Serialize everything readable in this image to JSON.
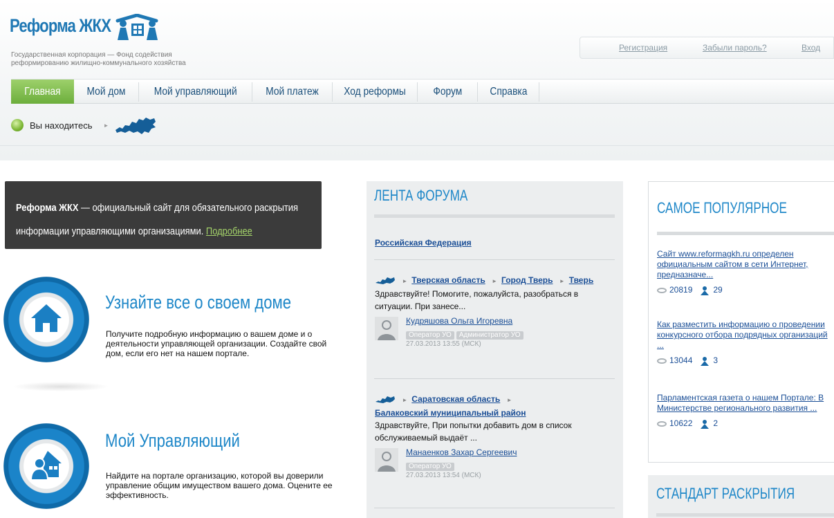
{
  "header": {
    "logo_title": "Реформа ЖКХ",
    "logo_subtitle_1": "Государственная корпорация — Фонд содействия",
    "logo_subtitle_2": "реформированию жилищно-коммунального хозяйства",
    "register": "Регистрация",
    "forgot_password": "Забыли пароль?",
    "login": "Вход"
  },
  "nav": {
    "items": [
      {
        "label": "Главная"
      },
      {
        "label": "Мой дом"
      },
      {
        "label": "Мой управляющий"
      },
      {
        "label": "Мой платеж"
      },
      {
        "label": "Ход реформы"
      },
      {
        "label": "Форум"
      },
      {
        "label": "Справка"
      }
    ],
    "active_color": "#7cbc48"
  },
  "breadcrumb": {
    "label": "Вы находитесь"
  },
  "intro": {
    "bold": "Реформа ЖКХ",
    "line1": " — официальный сайт для обязательного раскрытия",
    "line2": "информации управляющими организациями. ",
    "more": "Подробнее"
  },
  "features": [
    {
      "icon": "house-icon",
      "title": "Узнайте все о своем доме",
      "text": "Получите подробную информацию о вашем доме и о деятельности управляющей организации. Создайте свой дом, если его нет на нашем портале."
    },
    {
      "icon": "manager-house-icon",
      "title": "Мой Управляющий",
      "text": "Найдите на портале организацию, которой вы доверили управление общим имуществом вашего дома. Оцените ее эффективность."
    }
  ],
  "forum": {
    "title": "ЛЕНТА ФОРУМА",
    "region": "Российская Федерация",
    "posts": [
      {
        "path": [
          "Тверская область",
          "Город Тверь",
          "Тверь"
        ],
        "text": "Здравствуйте! Помогите, пожалуйста, разобраться в ситуации. При занесе...",
        "author": "Кудряшова Ольга Игоревна",
        "badges": [
          "Оператор УО",
          "Администратор УО"
        ],
        "date": "27.03.2013 13:55 (МСК)"
      },
      {
        "path": [
          "Саратовская область",
          "Балаковский муниципальный район"
        ],
        "text": "Здравствуйте, При попытки добавить дом в список обслуживаемый выдаёт ...",
        "author": "Манаенков Захар Сергеевич",
        "badges": [
          "Оператор УО"
        ],
        "date": "27.03.2013 13:54 (МСК)"
      }
    ]
  },
  "popular": {
    "title": "САМОЕ ПОПУЛЯРНОЕ",
    "items": [
      {
        "text": "Сайт www.reformagkh.ru определен официальным сайтом в сети Интернет, предназначе...",
        "views": "20819",
        "comments": "29"
      },
      {
        "text": "Как разместить информацию о проведении конкурсного отбора подрядных организаций ...",
        "views": "13044",
        "comments": "3"
      },
      {
        "text": "Парламентская газета о нашем Портале: В Министерстве регионального развития ...",
        "views": "10622",
        "comments": "2"
      }
    ]
  },
  "standard": {
    "title": "СТАНДАРТ РАСКРЫТИЯ"
  },
  "colors": {
    "brand_blue": "#1e87c8",
    "link": "#1a4e96",
    "green": "#7cbc48"
  }
}
